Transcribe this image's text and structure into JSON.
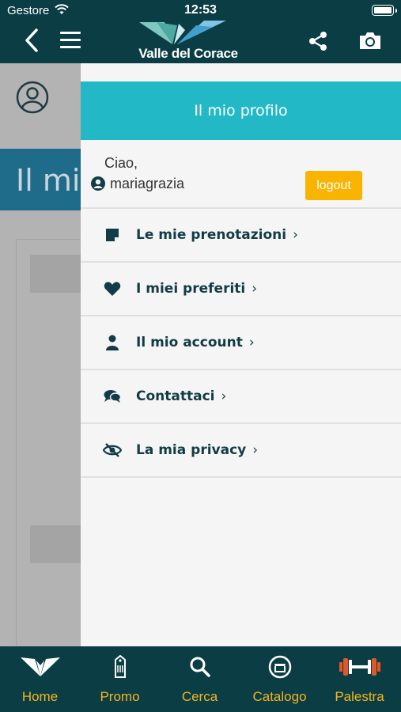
{
  "status_bar": {
    "carrier": "Gestore",
    "time": "12:53"
  },
  "header": {
    "logo_text": "Valle del Corace"
  },
  "underlay": {
    "banner_text": "Il mi"
  },
  "drawer": {
    "title": "Il mio profilo",
    "greeting": "Ciao,",
    "username": "mariagrazia",
    "logout_label": "logout",
    "items": [
      {
        "label": "Le mie prenotazioni",
        "icon": "note-icon"
      },
      {
        "label": "I miei preferiti",
        "icon": "heart-icon"
      },
      {
        "label": "Il mio account",
        "icon": "user-icon"
      },
      {
        "label": "Contattaci",
        "icon": "chat-icon"
      },
      {
        "label": "La mia privacy",
        "icon": "eye-slash-icon"
      }
    ],
    "chevron": "›"
  },
  "tabbar": {
    "tabs": [
      {
        "label": "Home",
        "icon": "logo-icon"
      },
      {
        "label": "Promo",
        "icon": "tag-icon"
      },
      {
        "label": "Cerca",
        "icon": "search-icon"
      },
      {
        "label": "Catalogo",
        "icon": "shop-icon"
      },
      {
        "label": "Palestra",
        "icon": "dumbbell-icon"
      }
    ]
  },
  "colors": {
    "primary_dark": "#0b3d45",
    "accent_teal": "#22b8c6",
    "accent_yellow": "#f8b400",
    "tab_label": "#f3b51c"
  }
}
